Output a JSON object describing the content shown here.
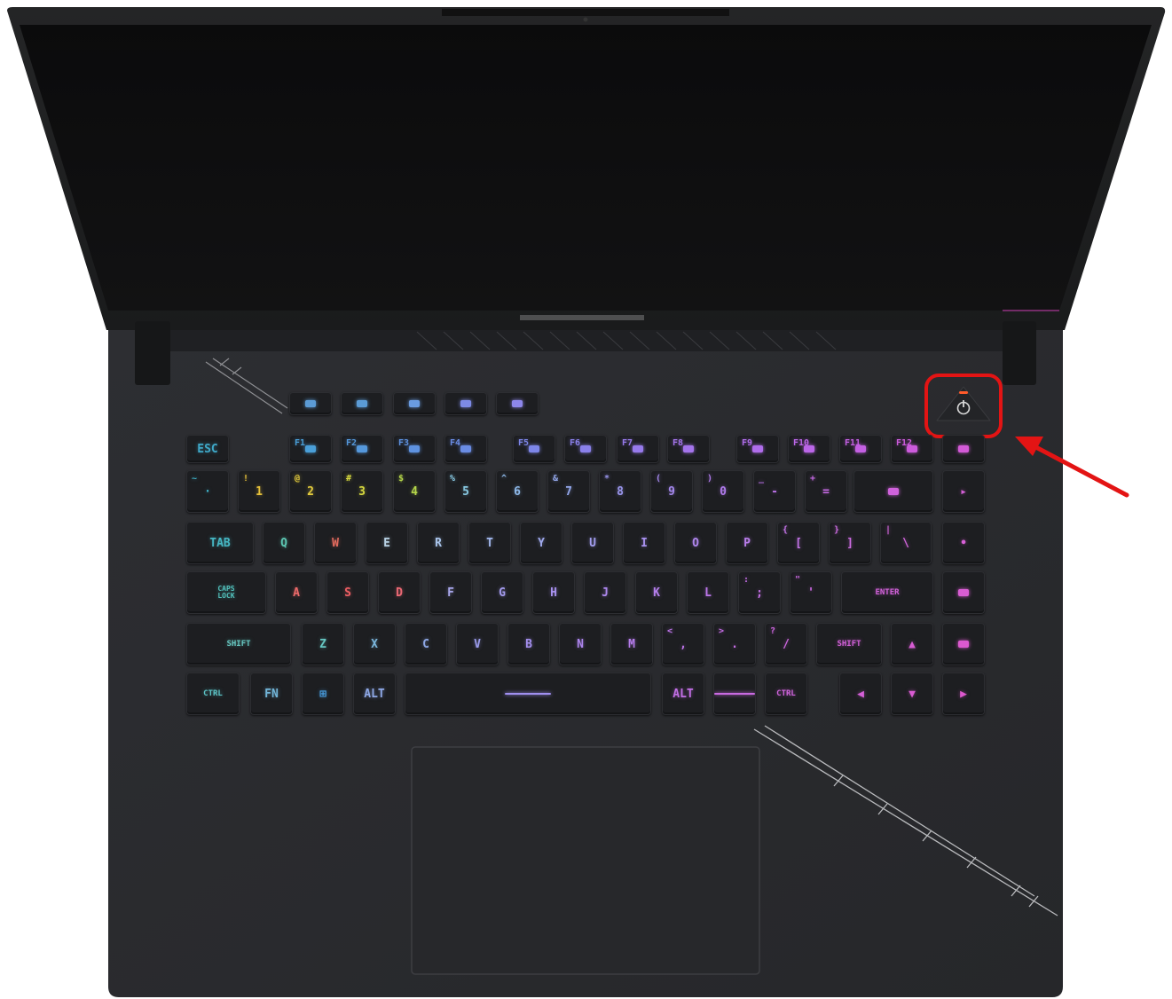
{
  "photo": {
    "subject": "laptop",
    "colors": {
      "background": "#ffffff",
      "chassis": "#2a2b2e",
      "deck": "#2b2c30",
      "bezel": "#141414",
      "screen": "#0d0d0d",
      "key": "#1d1e21",
      "highlight": "#e31414"
    }
  },
  "keyboard": {
    "rows": [
      [
        {
          "label": "",
          "sym": "",
          "color": "#5b9bd5"
        },
        {
          "label": "",
          "sym": "",
          "color": "#5b9bd5"
        },
        {
          "label": "",
          "sym": "",
          "color": "#6a9be0"
        },
        {
          "label": "",
          "sym": "",
          "color": "#7d8ae6"
        },
        {
          "label": "",
          "sym": "",
          "color": "#8d86ea"
        }
      ],
      [
        {
          "label": "ESC",
          "sym": "",
          "color": "#3fa9c9"
        },
        {
          "label": "",
          "sym": "F1",
          "color": "#4a9fd8"
        },
        {
          "label": "",
          "sym": "F2",
          "color": "#5598dc"
        },
        {
          "label": "",
          "sym": "F3",
          "color": "#5e92e0"
        },
        {
          "label": "",
          "sym": "F4",
          "color": "#6a8ce4"
        },
        {
          "label": "",
          "sym": "F5",
          "color": "#7d86e8"
        },
        {
          "label": "",
          "sym": "F6",
          "color": "#8a80ea"
        },
        {
          "label": "",
          "sym": "F7",
          "color": "#977aeb"
        },
        {
          "label": "",
          "sym": "F8",
          "color": "#a474eb"
        },
        {
          "label": "",
          "sym": "F9",
          "color": "#b06deb"
        },
        {
          "label": "",
          "sym": "F10",
          "color": "#bb66e8"
        },
        {
          "label": "",
          "sym": "F11",
          "color": "#c460e3"
        },
        {
          "label": "",
          "sym": "F12",
          "color": "#cc5bdc"
        },
        {
          "label": "",
          "sym": "",
          "color": "#d35ad7"
        }
      ],
      [
        {
          "label": "·",
          "sym": "~",
          "color": "#3fb2c8"
        },
        {
          "label": "1",
          "sym": "!",
          "color": "#e5c03a"
        },
        {
          "label": "2",
          "sym": "@",
          "color": "#e4cc3d"
        },
        {
          "label": "3",
          "sym": "#",
          "color": "#d7d93f"
        },
        {
          "label": "4",
          "sym": "$",
          "color": "#b5d64a"
        },
        {
          "label": "5",
          "sym": "%",
          "color": "#88c9e2"
        },
        {
          "label": "6",
          "sym": "^",
          "color": "#8db8e8"
        },
        {
          "label": "7",
          "sym": "&",
          "color": "#93a7ea"
        },
        {
          "label": "8",
          "sym": "*",
          "color": "#9a96ec"
        },
        {
          "label": "9",
          "sym": "(",
          "color": "#a487ec"
        },
        {
          "label": "0",
          "sym": ")",
          "color": "#b07bec"
        },
        {
          "label": "-",
          "sym": "_",
          "color": "#bb72e9"
        },
        {
          "label": "=",
          "sym": "+",
          "color": "#c66ae4"
        },
        {
          "label": "",
          "sym": "",
          "color": "#d062dc"
        },
        {
          "label": "▸",
          "sym": "",
          "color": "#d560d8"
        }
      ],
      [
        {
          "label": "TAB",
          "sym": "",
          "color": "#46b7c4"
        },
        {
          "label": "Q",
          "sym": "",
          "color": "#5dc7b3"
        },
        {
          "label": "W",
          "sym": "",
          "color": "#e36b5e"
        },
        {
          "label": "E",
          "sym": "",
          "color": "#b8d2e4"
        },
        {
          "label": "R",
          "sym": "",
          "color": "#a9c4ea"
        },
        {
          "label": "T",
          "sym": "",
          "color": "#a2b7ec"
        },
        {
          "label": "Y",
          "sym": "",
          "color": "#a0aaee"
        },
        {
          "label": "U",
          "sym": "",
          "color": "#a29def"
        },
        {
          "label": "I",
          "sym": "",
          "color": "#a891ef"
        },
        {
          "label": "O",
          "sym": "",
          "color": "#b086ee"
        },
        {
          "label": "P",
          "sym": "",
          "color": "#b97deb"
        },
        {
          "label": "[",
          "sym": "{",
          "color": "#c374e7"
        },
        {
          "label": "]",
          "sym": "}",
          "color": "#cc6ce1"
        },
        {
          "label": "\\",
          "sym": "|",
          "color": "#d265db"
        },
        {
          "label": "•",
          "sym": "",
          "color": "#d760d6"
        }
      ],
      [
        {
          "label": "CAPS\nLOCK",
          "sym": "",
          "color": "#52c0bb"
        },
        {
          "label": "A",
          "sym": "",
          "color": "#ec6a6a"
        },
        {
          "label": "S",
          "sym": "",
          "color": "#ee5f64"
        },
        {
          "label": "D",
          "sym": "",
          "color": "#ea6873"
        },
        {
          "label": "F",
          "sym": "",
          "color": "#a8a6ea"
        },
        {
          "label": "G",
          "sym": "",
          "color": "#a49bee"
        },
        {
          "label": "H",
          "sym": "",
          "color": "#a891ef"
        },
        {
          "label": "J",
          "sym": "",
          "color": "#ae88ef"
        },
        {
          "label": "K",
          "sym": "",
          "color": "#b57fed"
        },
        {
          "label": "L",
          "sym": "",
          "color": "#bc77ea"
        },
        {
          "label": ";",
          "sym": ":",
          "color": "#c46fe6"
        },
        {
          "label": "'",
          "sym": "\"",
          "color": "#cb68e1"
        },
        {
          "label": "ENTER",
          "sym": "",
          "color": "#d262da"
        },
        {
          "label": "",
          "sym": "",
          "color": "#d95dd3"
        }
      ],
      [
        {
          "label": "SHIFT",
          "sym": "",
          "color": "#66c6c0"
        },
        {
          "label": "Z",
          "sym": "",
          "color": "#66c7c2"
        },
        {
          "label": "X",
          "sym": "",
          "color": "#7bb6dc"
        },
        {
          "label": "C",
          "sym": "",
          "color": "#8ea8e6"
        },
        {
          "label": "V",
          "sym": "",
          "color": "#9a9bec"
        },
        {
          "label": "B",
          "sym": "",
          "color": "#a48fee"
        },
        {
          "label": "N",
          "sym": "",
          "color": "#ad85ee"
        },
        {
          "label": "M",
          "sym": "",
          "color": "#b57ceb"
        },
        {
          "label": ",",
          "sym": "<",
          "color": "#bd74e8"
        },
        {
          "label": ".",
          "sym": ">",
          "color": "#c56de4"
        },
        {
          "label": "/",
          "sym": "?",
          "color": "#cc66de"
        },
        {
          "label": "SHIFT",
          "sym": "",
          "color": "#d260d8"
        },
        {
          "label": "▲",
          "sym": "",
          "color": "#d75cd3"
        },
        {
          "label": "",
          "sym": "",
          "color": "#dc59cf"
        }
      ],
      [
        {
          "label": "CTRL",
          "sym": "",
          "color": "#5cc3c5"
        },
        {
          "label": "FN",
          "sym": "",
          "color": "#72b5d8"
        },
        {
          "label": "⊞",
          "sym": "",
          "color": "#4aa3e8"
        },
        {
          "label": "ALT",
          "sym": "",
          "color": "#8ea8e6"
        },
        {
          "label": "",
          "sym": "",
          "color": "#a08ff0"
        },
        {
          "label": "ALT",
          "sym": "",
          "color": "#c26fe5"
        },
        {
          "label": "",
          "sym": "",
          "color": "#c96ae1"
        },
        {
          "label": "CTRL",
          "sym": "",
          "color": "#cf64dc"
        },
        {
          "label": "◀",
          "sym": "",
          "color": "#d45fd7"
        },
        {
          "label": "▼",
          "sym": "",
          "color": "#d95bd2"
        },
        {
          "label": "▶",
          "sym": "",
          "color": "#dd58ce"
        }
      ]
    ]
  },
  "power_button": {
    "glyph": "⏻",
    "led_color": "#ff5a2a"
  },
  "annotation": {
    "color": "#e31414"
  }
}
